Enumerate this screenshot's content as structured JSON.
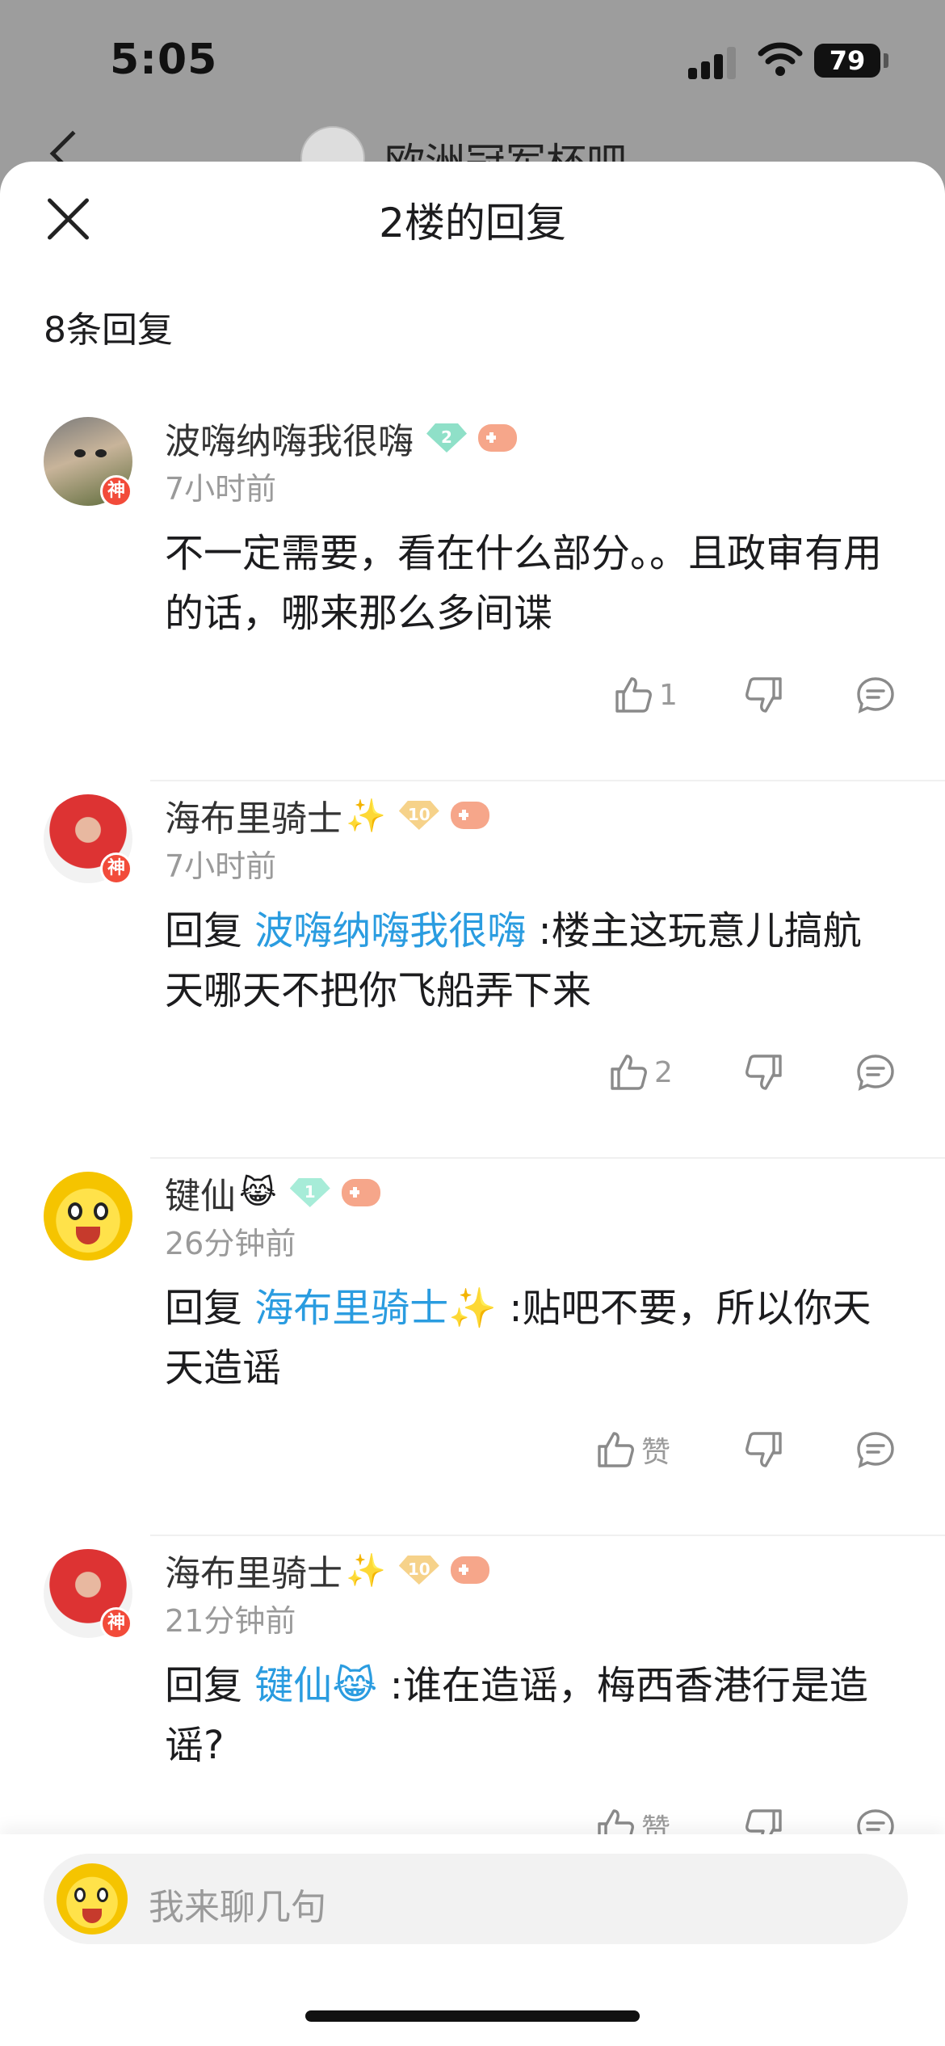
{
  "status": {
    "time": "5:05",
    "battery": "79"
  },
  "background": {
    "forum_title": "欧洲冠军杯吧"
  },
  "sheet": {
    "title": "2楼的回复",
    "reply_count": "8条回复"
  },
  "comments": [
    {
      "username": "波嗨纳嗨我很嗨",
      "name_emoji": "",
      "level": "2",
      "level_color": "#8fe0c8",
      "time": "7小时前",
      "reply_prefix": "",
      "mention": "",
      "mention_emoji": "",
      "text": "不一定需要，看在什么部分。。且政审有用的话，哪来那么多间谍",
      "like_label": "1"
    },
    {
      "username": "海布里骑士",
      "name_emoji": "✨",
      "level": "10",
      "level_color": "#f6d28a",
      "time": "7小时前",
      "reply_prefix": "回复 ",
      "mention": "波嗨纳嗨我很嗨",
      "mention_emoji": "",
      "text": ":楼主这玩意儿搞航天哪天不把你飞船弄下来",
      "like_label": "2"
    },
    {
      "username": "键仙",
      "name_emoji": "😹",
      "level": "1",
      "level_color": "#a7ecd8",
      "time": "26分钟前",
      "reply_prefix": "回复 ",
      "mention": "海布里骑士",
      "mention_emoji": "✨",
      "text": ":贴吧不要，所以你天天造谣",
      "like_label": "赞"
    },
    {
      "username": "海布里骑士",
      "name_emoji": "✨",
      "level": "10",
      "level_color": "#f6d28a",
      "time": "21分钟前",
      "reply_prefix": "回复 ",
      "mention": "键仙",
      "mention_emoji": "😹",
      "text": ":谁在造谣，梅西香港行是造谣?",
      "like_label": "赞"
    }
  ],
  "badge_text": "神",
  "input": {
    "placeholder": "我来聊几句"
  },
  "colors": {
    "mention": "#2a9ce0",
    "badge": "#f24b3a"
  }
}
